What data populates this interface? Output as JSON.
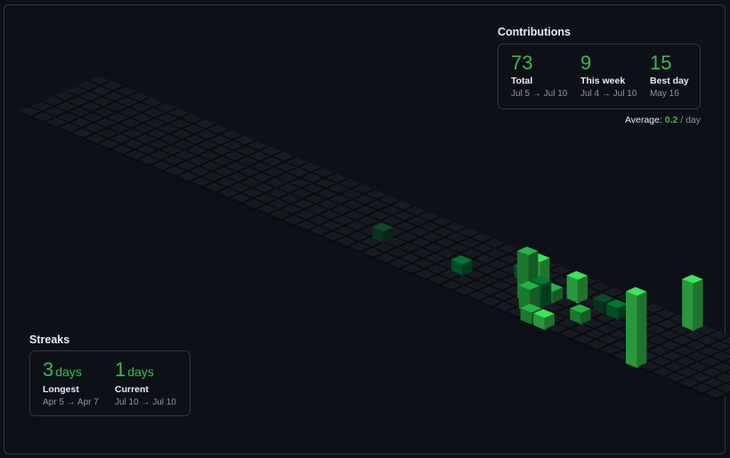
{
  "contributions": {
    "title": "Contributions",
    "stats": [
      {
        "value": "73",
        "label": "Total",
        "range": "Jul 5 → Jul 10"
      },
      {
        "value": "9",
        "label": "This week",
        "range": "Jul 4 → Jul 10"
      },
      {
        "value": "15",
        "label": "Best day",
        "range": "May 16"
      }
    ],
    "average_label": "Average:",
    "average_value": "0.2",
    "average_unit": "/ day"
  },
  "streaks": {
    "title": "Streaks",
    "longest": {
      "value": "3",
      "unit": "days",
      "label": "Longest",
      "range": "Apr 5 → Apr 7"
    },
    "current": {
      "value": "1",
      "unit": "days",
      "label": "Current",
      "range": "Jul 10 → Jul 10"
    }
  },
  "colors": {
    "background": "#0d1117",
    "empty_cell": "#161b22",
    "level1": "#0e4429",
    "level2": "#006d32",
    "level3": "#26a641",
    "level4": "#39d353",
    "accent": "#3fb950"
  },
  "calendar": {
    "weeks": 53,
    "days_per_week": 7,
    "active_cells": [
      {
        "week": 25,
        "day": 2,
        "level": 1,
        "height": 1
      },
      {
        "week": 31,
        "day": 2,
        "level": 2,
        "height": 1
      },
      {
        "week": 36,
        "day": 2,
        "level": 3,
        "height": 4
      },
      {
        "week": 37,
        "day": 1,
        "level": 3,
        "height": 2
      },
      {
        "week": 37,
        "day": 2,
        "level": 2,
        "height": 2
      },
      {
        "week": 38,
        "day": 0,
        "level": 3,
        "height": 1
      },
      {
        "week": 36,
        "day": 3,
        "level": 4,
        "height": 3
      },
      {
        "week": 39,
        "day": 0,
        "level": 4,
        "height": 1
      },
      {
        "week": 34,
        "day": 4,
        "level": 2,
        "height": 1
      },
      {
        "week": 37,
        "day": 3,
        "level": 3,
        "height": 1
      },
      {
        "week": 38,
        "day": 4,
        "level": 4,
        "height": 2
      },
      {
        "week": 40,
        "day": 2,
        "level": 3,
        "height": 1
      },
      {
        "week": 40,
        "day": 4,
        "level": 1,
        "height": 1
      },
      {
        "week": 41,
        "day": 4,
        "level": 2,
        "height": 1
      },
      {
        "week": 46,
        "day": 0,
        "level": 4,
        "height": 6
      },
      {
        "week": 45,
        "day": 6,
        "level": 4,
        "height": 4
      }
    ]
  }
}
